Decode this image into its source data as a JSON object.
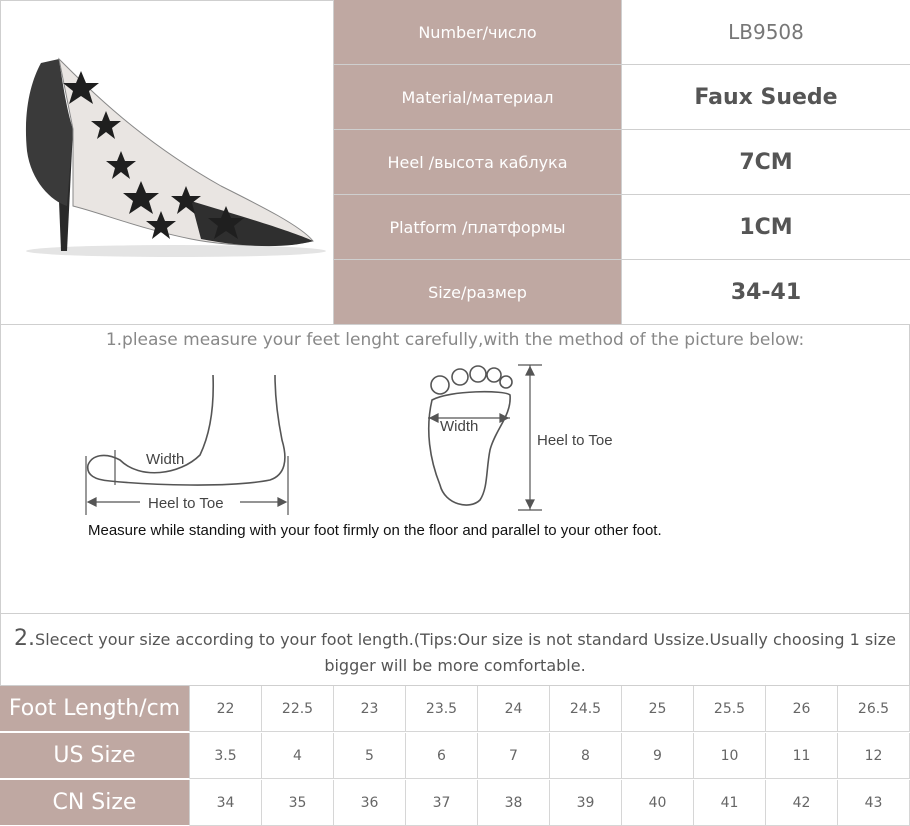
{
  "specs": [
    {
      "label": "Number/число",
      "value": "LB9508"
    },
    {
      "label": "Material/материал",
      "value": "Faux Suede"
    },
    {
      "label": "Heel /высота каблука",
      "value": "7CM"
    },
    {
      "label": "Platform /платформы",
      "value": "1CM"
    },
    {
      "label": "Size/размер",
      "value": "34-41"
    }
  ],
  "measure": {
    "title": "1.please measure your feet lenght carefully,with the method of the picture below:",
    "width_label": "Width",
    "heel_toe_label": "Heel to Toe",
    "caption": "Measure while standing with your foot firmly on the floor and parallel to your other foot."
  },
  "tip": {
    "number": "2.",
    "text": "Slecect your size according to your foot length.(Tips:Our size is not standard Ussize.Usually choosing 1 size bigger will be more comfortable."
  },
  "size_table": {
    "rows": [
      {
        "label": "Foot Length/cm",
        "values": [
          "22",
          "22.5",
          "23",
          "23.5",
          "24",
          "24.5",
          "25",
          "25.5",
          "26",
          "26.5"
        ]
      },
      {
        "label": "US Size",
        "values": [
          "3.5",
          "4",
          "5",
          "6",
          "7",
          "8",
          "9",
          "10",
          "11",
          "12"
        ]
      },
      {
        "label": "CN Size",
        "values": [
          "34",
          "35",
          "36",
          "37",
          "38",
          "39",
          "40",
          "41",
          "42",
          "43"
        ]
      }
    ]
  },
  "colors": {
    "label_bg": "#bfa8a2",
    "border": "#cfcfcf"
  }
}
